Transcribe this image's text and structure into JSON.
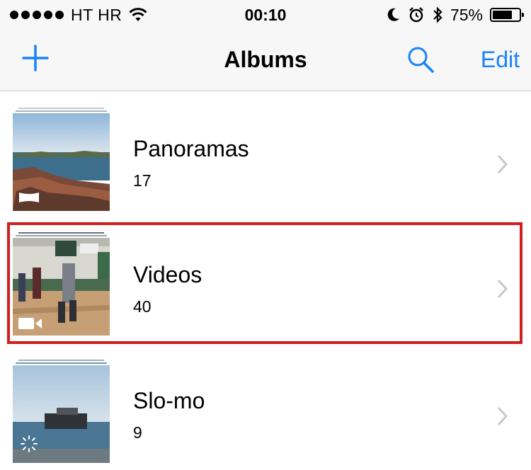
{
  "status_bar": {
    "carrier": "HT HR",
    "time": "00:10",
    "battery_percent": "75%",
    "battery_level": 0.75,
    "icons": [
      "signal-dots-icon",
      "wifi-icon",
      "moon-icon",
      "alarm-icon",
      "bluetooth-icon",
      "battery-icon"
    ]
  },
  "nav": {
    "title": "Albums",
    "add_icon": "plus-icon",
    "search_icon": "search-icon",
    "edit_label": "Edit"
  },
  "albums": [
    {
      "title": "Panoramas",
      "count": "17",
      "badge_icon": "panorama-icon"
    },
    {
      "title": "Videos",
      "count": "40",
      "badge_icon": "video-camera-icon",
      "highlighted": true
    },
    {
      "title": "Slo-mo",
      "count": "9",
      "badge_icon": "slo-mo-icon"
    }
  ],
  "colors": {
    "accent": "#1a82fb",
    "highlight_border": "#d11f1f",
    "bar_background": "#f7f7f7"
  }
}
